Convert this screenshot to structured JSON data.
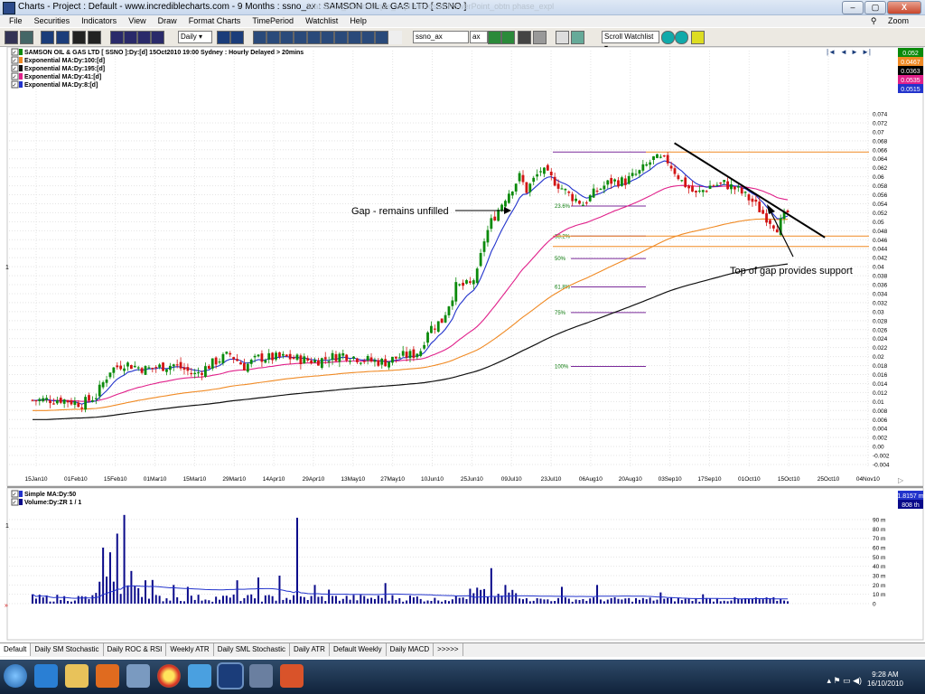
{
  "window": {
    "title": "Charts - Project : Default - www.incrediblecharts.com - 9 Months : ssno_ax : SAMSON OIL & GAS LTD  [ SSNO ]",
    "ghost_tabs": "Mar 2010_nearmatique_expl   Microsoft PowerPoint_obtn phase_expl"
  },
  "menu": {
    "items": [
      "File",
      "Securities",
      "Indicators",
      "View",
      "Draw",
      "Format Charts",
      "TimePeriod",
      "Watchlist",
      "Help"
    ],
    "zoom": "Zoom"
  },
  "toolbar": {
    "period": "Daily",
    "search": "ssno_ax",
    "exchange": "ax",
    "watchlist": "Scroll Watchlist"
  },
  "chart": {
    "header": "SAMSON OIL & GAS LTD [ SSNO ]:Dy:[d]  15Oct2010 19:00 Sydney : Hourly Delayed > 20mins",
    "legend": [
      "Exponential MA:Dy:100:[d]",
      "Exponential MA:Dy:195:[d]",
      "Exponential MA:Dy:41:[d]",
      "Exponential MA:Dy:8:[d]"
    ],
    "badges": [
      "0.052",
      "0.0467",
      "0.0363",
      "0.0535",
      "0.0515"
    ],
    "y_ticks": [
      "0.074",
      "0.072",
      "0.07",
      "0.068",
      "0.066",
      "0.064",
      "0.062",
      "0.06",
      "0.058",
      "0.056",
      "0.054",
      "0.052",
      "0.05",
      "0.048",
      "0.046",
      "0.044",
      "0.042",
      "0.04",
      "0.038",
      "0.036",
      "0.034",
      "0.032",
      "0.03",
      "0.028",
      "0.026",
      "0.024",
      "0.022",
      "0.02",
      "0.018",
      "0.016",
      "0.014",
      "0.012",
      "0.01",
      "0.008",
      "0.006",
      "0.004",
      "0.002",
      "0.00",
      "-0.002",
      "-0.004"
    ],
    "x_ticks": [
      "15Jan10",
      "01Feb10",
      "15Feb10",
      "01Mar10",
      "15Mar10",
      "29Mar10",
      "14Apr10",
      "29Apr10",
      "13May10",
      "27May10",
      "10Jun10",
      "25Jun10",
      "09Jul10",
      "23Jul10",
      "06Aug10",
      "20Aug10",
      "03Sep10",
      "17Sep10",
      "01Oct10",
      "15Oct10",
      "25Oct10",
      "04Nov10"
    ],
    "fib_labels": [
      "23.6%",
      "38.2%",
      "50%",
      "61.8%",
      "75%",
      "100%"
    ],
    "annotations": {
      "gap": "Gap - remains unfilled",
      "support": "Top of gap provides support"
    },
    "scale_label": "1",
    "vol_legend": [
      "Simple MA:Dy:50",
      "Volume:Dy:ZR 1 / 1"
    ],
    "vol_badges": [
      "1.8157 m",
      "808 th"
    ],
    "vol_ticks": [
      "90 m",
      "80 m",
      "70 m",
      "60 m",
      "50 m",
      "40 m",
      "30 m",
      "20 m",
      "10 m",
      "0"
    ],
    "vol_scale_label": "1",
    "vol_scale_label2": "»"
  },
  "chart_data": {
    "type": "candlestick",
    "y_range": [
      -0.004,
      0.075
    ],
    "legend_series": [
      "Exponential MA:Dy:100:[d]",
      "Exponential MA:Dy:195:[d]",
      "Exponential MA:Dy:41:[d]",
      "Exponential MA:Dy:8:[d]"
    ],
    "fib_levels": [
      0.0535,
      0.0468,
      0.0418,
      0.0355,
      0.0298,
      0.0178
    ],
    "horizontal_lines": [
      0.0655,
      0.0468,
      0.0445
    ],
    "trendline": [
      [
        "31Aug10",
        0.0675
      ],
      [
        "25Oct10",
        0.0465
      ]
    ]
  },
  "tabs": [
    "Default",
    "Daily SM Stochastic",
    "Daily ROC & RSI",
    "Weekly ATR",
    "Daily SML Stochastic",
    "Daily ATR",
    "Default Weekly",
    "Daily MACD",
    ">>>>>"
  ],
  "taskbar": {
    "time": "9:28 AM",
    "date": "16/10/2010"
  }
}
